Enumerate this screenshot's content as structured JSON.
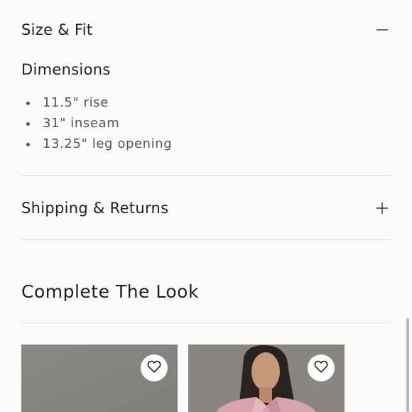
{
  "size_fit": {
    "title": "Size & Fit",
    "toggle_icon": "minus-icon",
    "dimensions_title": "Dimensions",
    "dimensions": [
      "11.5\" rise",
      "31\" inseam",
      "13.25\" leg opening"
    ]
  },
  "shipping": {
    "title": "Shipping & Returns",
    "toggle_icon": "plus-icon"
  },
  "complete_the_look": {
    "title": "Complete The Look",
    "products": [
      {
        "favorite_icon": "heart-icon"
      },
      {
        "favorite_icon": "heart-icon"
      }
    ]
  }
}
